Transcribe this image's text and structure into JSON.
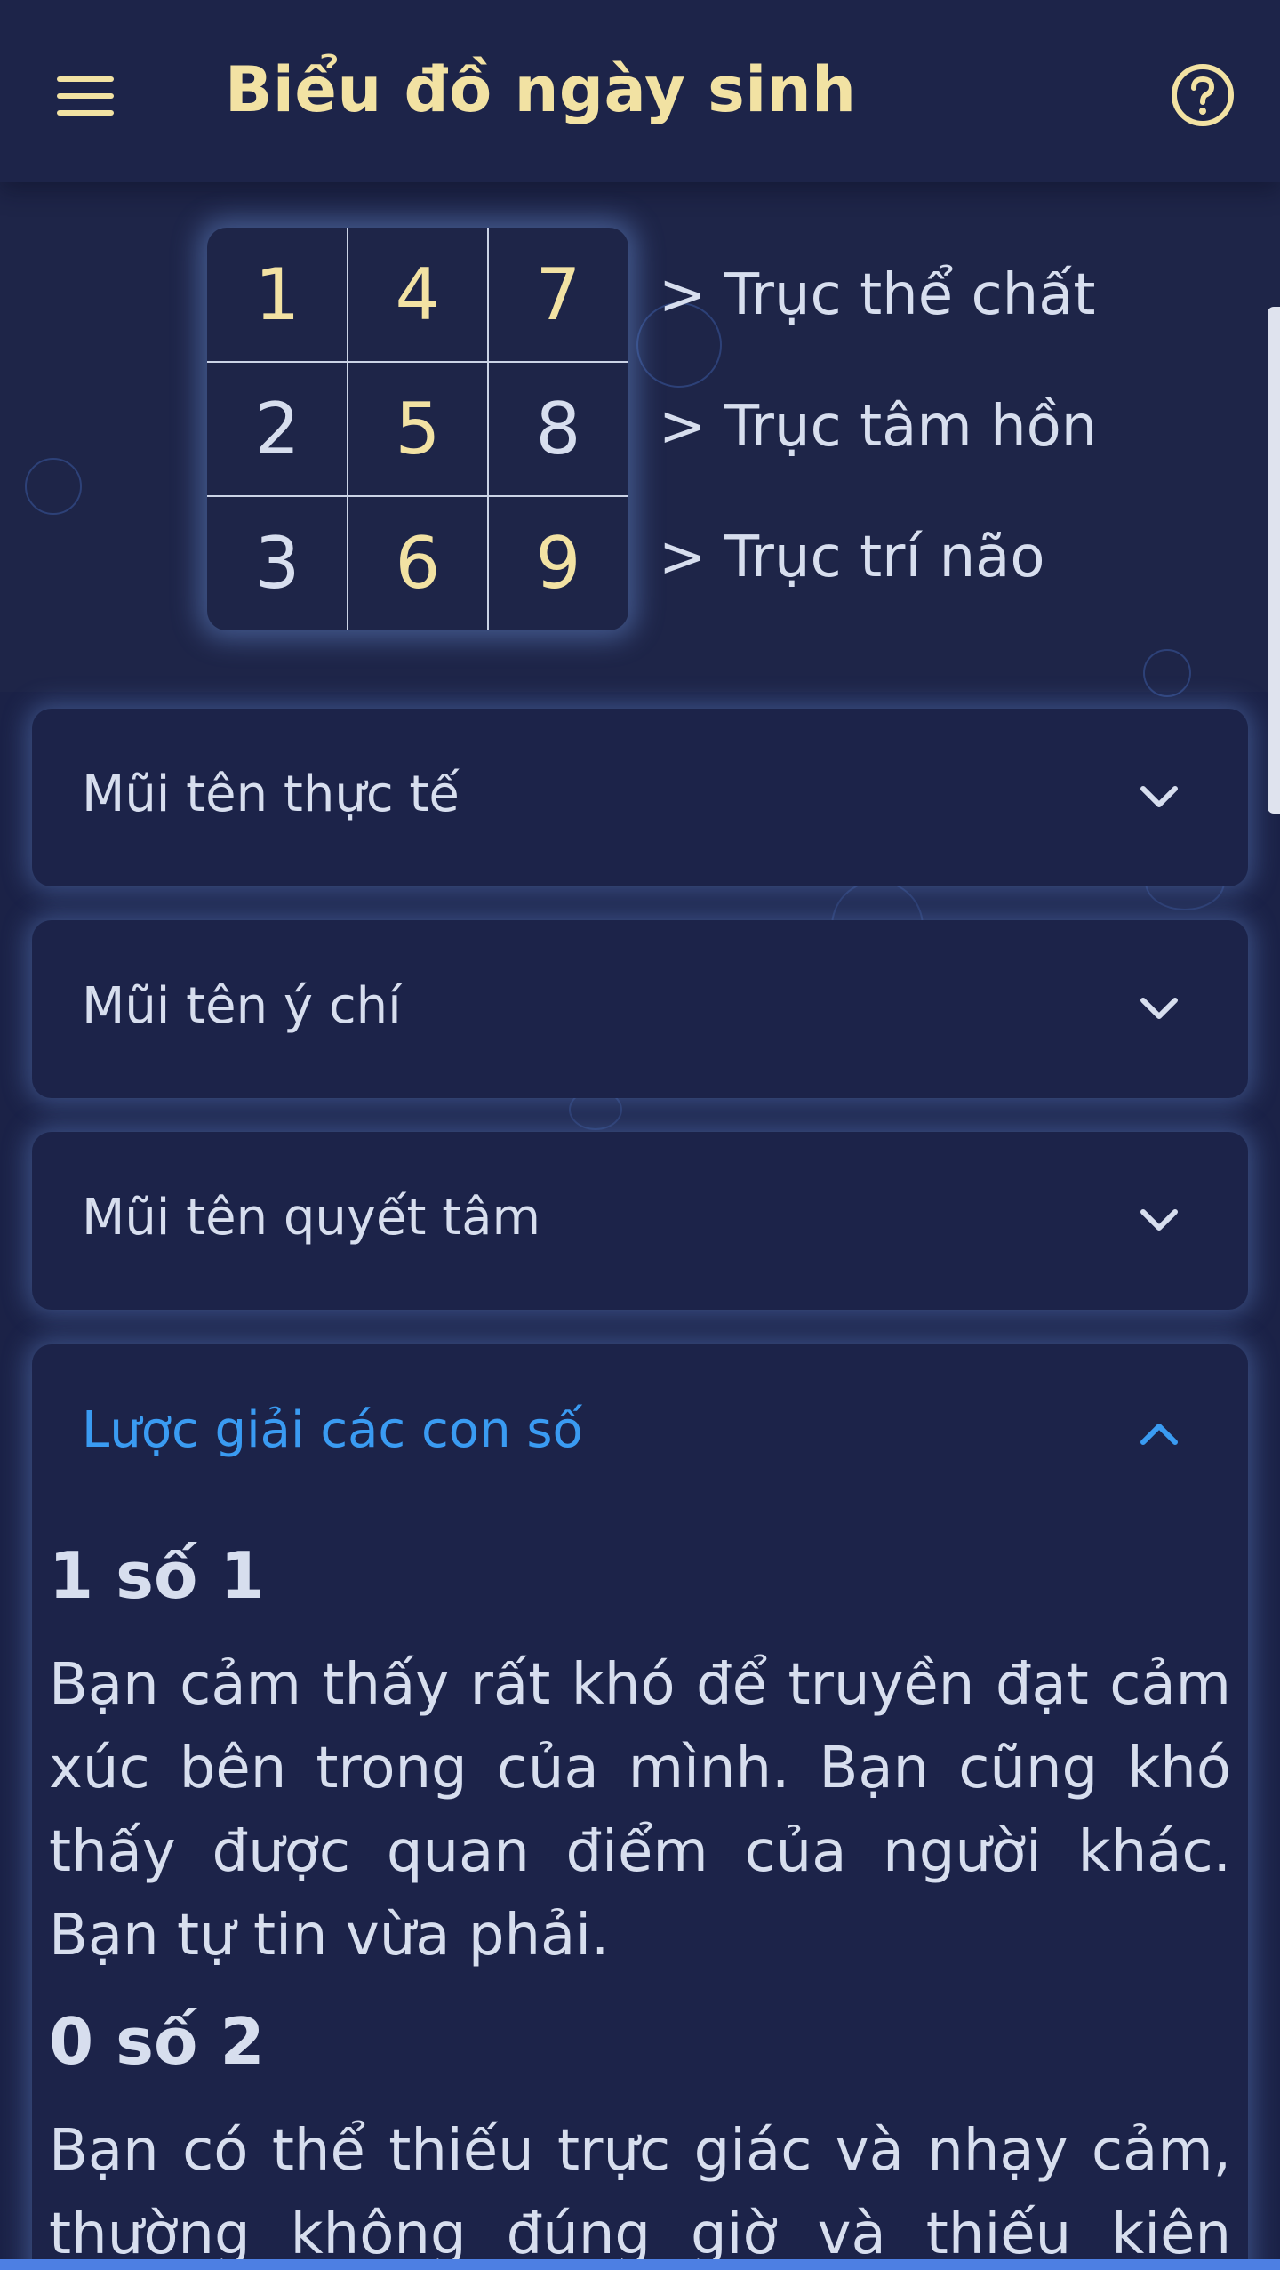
{
  "header": {
    "title": "Biểu đồ ngày sinh",
    "menu_icon": "hamburger-menu-icon",
    "help_icon": "question-circle-icon"
  },
  "birth_chart": {
    "rows": [
      {
        "cells": [
          "1",
          "4",
          "7"
        ],
        "axis_label": "> Trục thể chất"
      },
      {
        "cells": [
          "2",
          "5",
          "8"
        ],
        "axis_label": "> Trục tâm hồn"
      },
      {
        "cells": [
          "3",
          "6",
          "9"
        ],
        "axis_label": "> Trục trí não"
      }
    ],
    "highlight_color": "#f2e2a3",
    "normal_color": "#d7deee"
  },
  "accordions": [
    {
      "title": "Mũi tên thực tế",
      "expanded": false,
      "icon": "chevron-down-icon"
    },
    {
      "title": "Mũi tên ý chí",
      "expanded": false,
      "icon": "chevron-down-icon"
    },
    {
      "title": "Mũi tên quyết tâm",
      "expanded": false,
      "icon": "chevron-down-icon"
    },
    {
      "title": "Lược giải các con số",
      "expanded": true,
      "icon": "chevron-up-icon"
    }
  ],
  "interpretation": [
    {
      "heading": "1 số 1",
      "text": "Bạn cảm thấy rất khó để truyền đạt cảm xúc bên trong của mình. Bạn cũng khó thấy được quan điểm của người khác. Bạn tự tin vừa phải."
    },
    {
      "heading": "0 số 2",
      "text": "Bạn có thể thiếu trực giác và nhạy cảm, thường không đúng giờ và thiếu kiên nhẫn."
    }
  ],
  "colors": {
    "background": "#1b2247",
    "accent_gold": "#f2e2a3",
    "accent_blue": "#3a9bf2",
    "text": "#d7deee"
  }
}
